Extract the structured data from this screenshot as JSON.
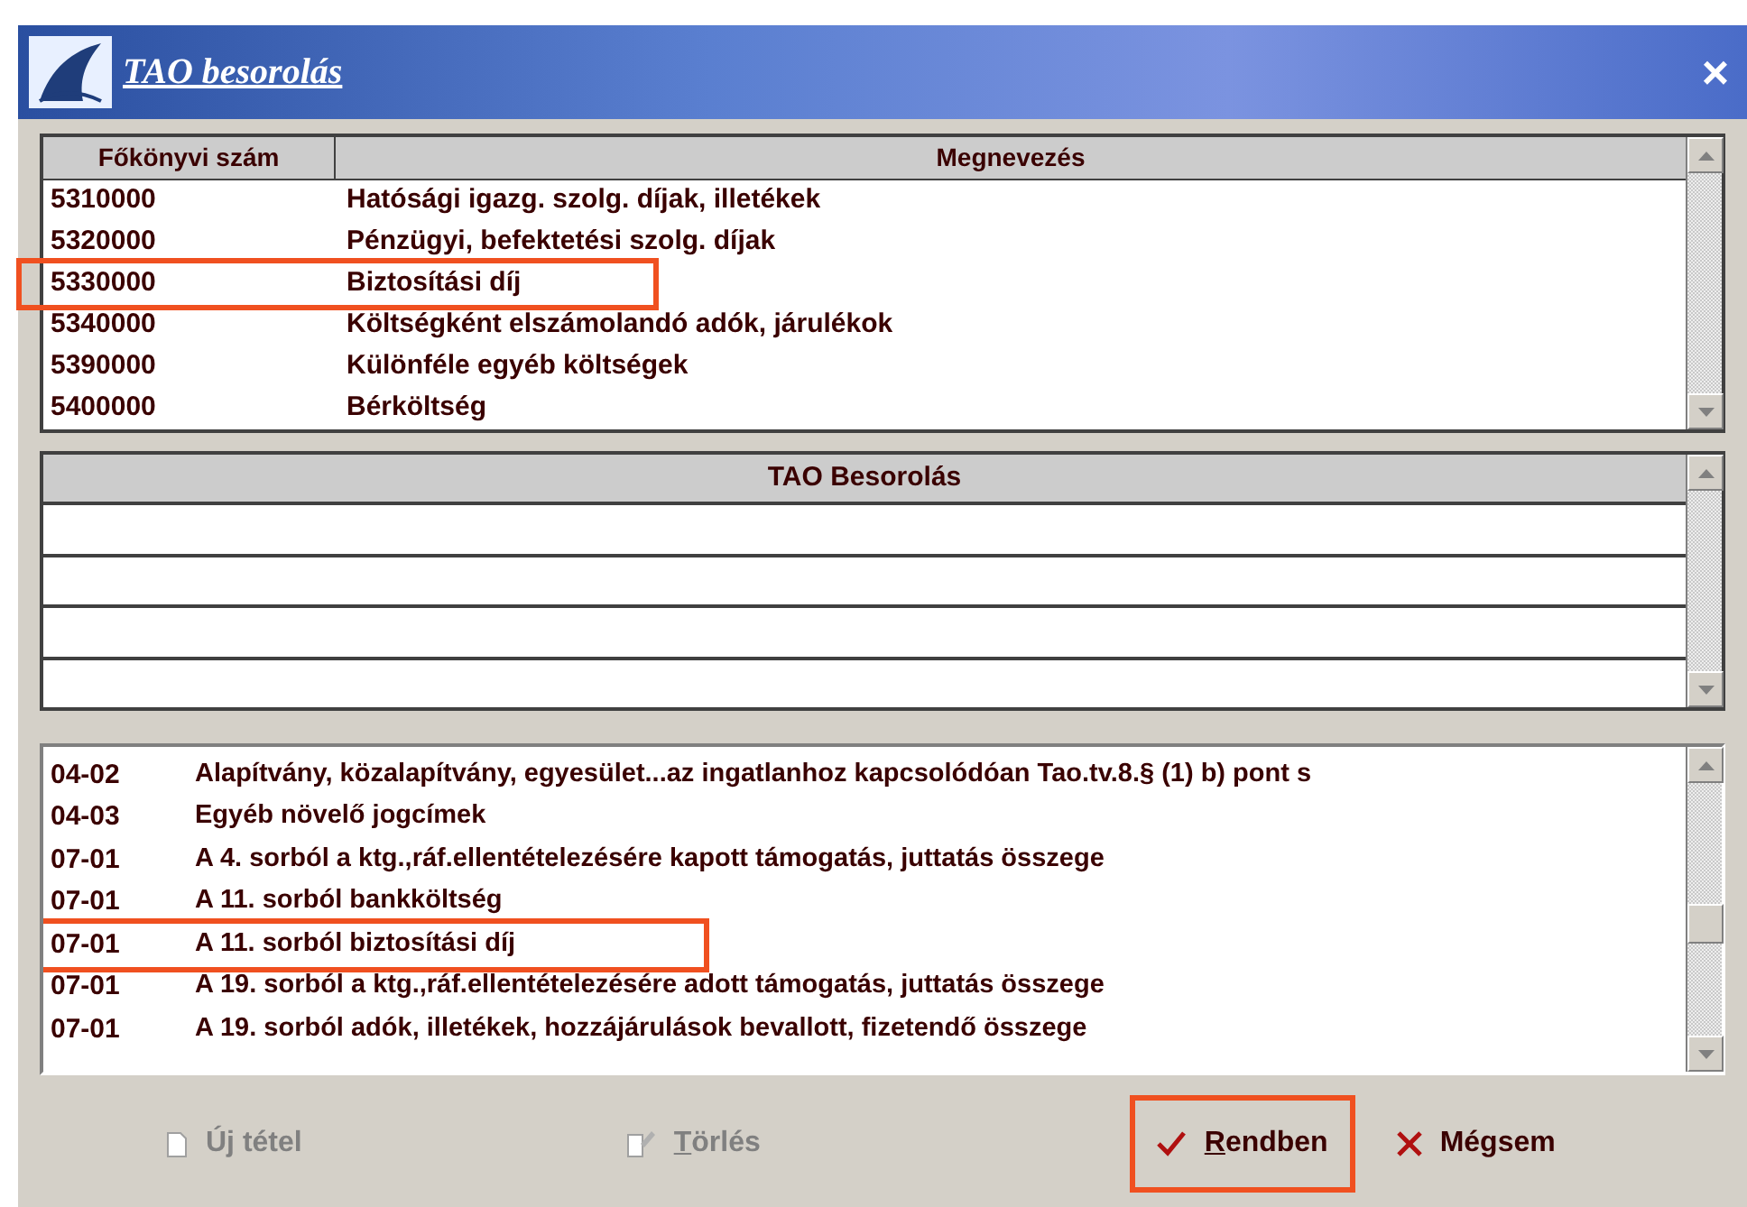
{
  "window": {
    "title": "TAO besorolás",
    "close": "×"
  },
  "accounts": {
    "columns": [
      "Főkönyvi szám",
      "Megnevezés"
    ],
    "rows": [
      {
        "code": "5310000",
        "name": "Hatósági igazg. szolg. díjak, illetékek",
        "highlighted": false
      },
      {
        "code": "5320000",
        "name": "Pénzügyi, befektetési szolg. díjak",
        "highlighted": false
      },
      {
        "code": "5330000",
        "name": "Biztosítási díj",
        "highlighted": true
      },
      {
        "code": "5340000",
        "name": "Költségként elszámolandó adók, járulékok",
        "highlighted": false
      },
      {
        "code": "5390000",
        "name": "Különféle egyéb költségek",
        "highlighted": false
      },
      {
        "code": "5400000",
        "name": "Bérköltség",
        "highlighted": false
      }
    ]
  },
  "classification": {
    "column": "TAO Besorolás"
  },
  "categories": {
    "rows": [
      {
        "code": "04-02",
        "name": "Alapítvány, közalapítvány, egyesület...az ingatlanhoz kapcsolódóan Tao.tv.8.§ (1) b) pont s",
        "highlighted": false
      },
      {
        "code": "04-03",
        "name": "Egyéb növelő jogcímek",
        "highlighted": false
      },
      {
        "code": "07-01",
        "name": "A 4. sorból a ktg.,ráf.ellentételezésére kapott támogatás, juttatás összege",
        "highlighted": false
      },
      {
        "code": "07-01",
        "name": "A 11. sorból bankköltség",
        "highlighted": false
      },
      {
        "code": "07-01",
        "name": "A 11. sorból biztosítási díj",
        "highlighted": true
      },
      {
        "code": "07-01",
        "name": "A 19. sorból a ktg.,ráf.ellentételezésére adott támogatás, juttatás összege",
        "highlighted": false
      },
      {
        "code": "07-01",
        "name": "A 19. sorból adók, illetékek, hozzájárulások bevallott, fizetendő összege",
        "highlighted": false
      }
    ]
  },
  "buttons": [
    {
      "kind": "new",
      "label": "Új tétel",
      "disabled": true,
      "highlighted": false,
      "underline_first": false
    },
    {
      "kind": "delete",
      "label": "Törlés",
      "disabled": true,
      "highlighted": false,
      "underline_first": true
    },
    {
      "kind": "ok",
      "label": "Rendben",
      "disabled": false,
      "highlighted": true,
      "underline_first": true
    },
    {
      "kind": "cancel",
      "label": "Mégsem",
      "disabled": false,
      "highlighted": false,
      "underline_first": false
    }
  ]
}
